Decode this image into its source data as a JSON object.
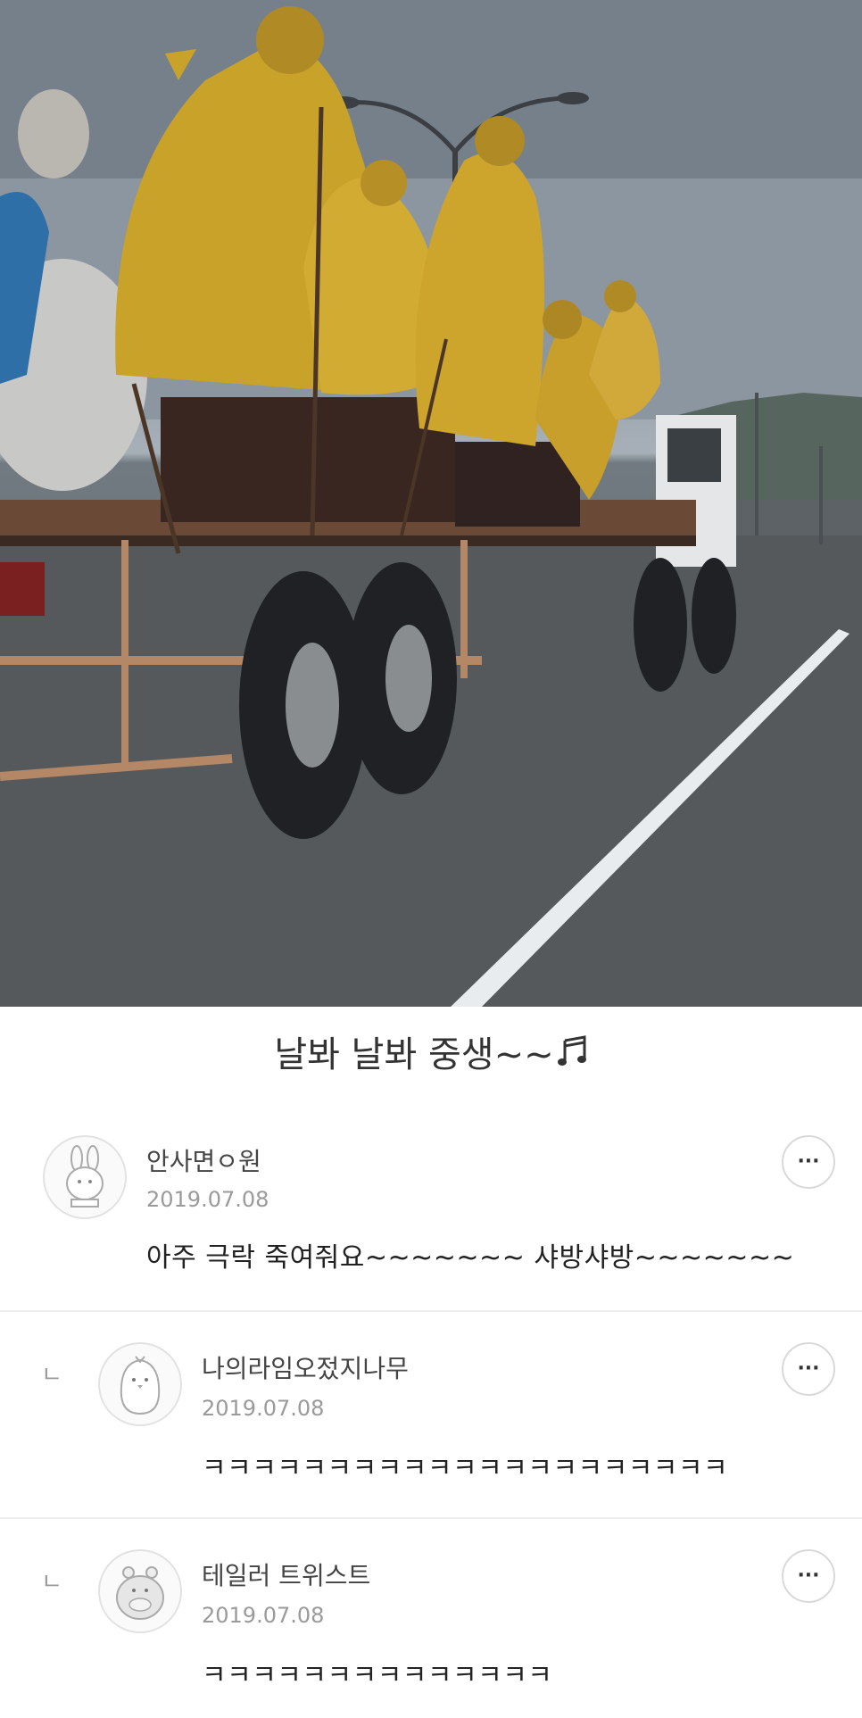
{
  "post": {
    "caption": "날봐 날봐 중생~~",
    "caption_icon": "music-note-icon"
  },
  "comments": [
    {
      "author": "안사면ㅇ원",
      "date": "2019.07.08",
      "text": "아주 극락 죽여줘요~~~~~~~ 샤방샤방~~~~~~~",
      "avatar": "rabbit-avatar",
      "more": "···"
    },
    {
      "reply_marker": "ㄴ",
      "author": "나의라임오젔지나무",
      "date": "2019.07.08",
      "text": "ㅋㅋㅋㅋㅋㅋㅋㅋㅋㅋㅋㅋㅋㅋㅋㅋㅋㅋㅋㅋㅋ",
      "avatar": "penguin-avatar",
      "more": "···"
    },
    {
      "reply_marker": "ㄴ",
      "author": "테일러 트위스트",
      "date": "2019.07.08",
      "text": "ㅋㅋㅋㅋㅋㅋㅋㅋㅋㅋㅋㅋㅋㅋ",
      "avatar": "hippo-avatar",
      "more": "···"
    }
  ],
  "colors": {
    "gold": "#c9a22a",
    "road": "#5e6367",
    "sky": "#8e98a3"
  }
}
